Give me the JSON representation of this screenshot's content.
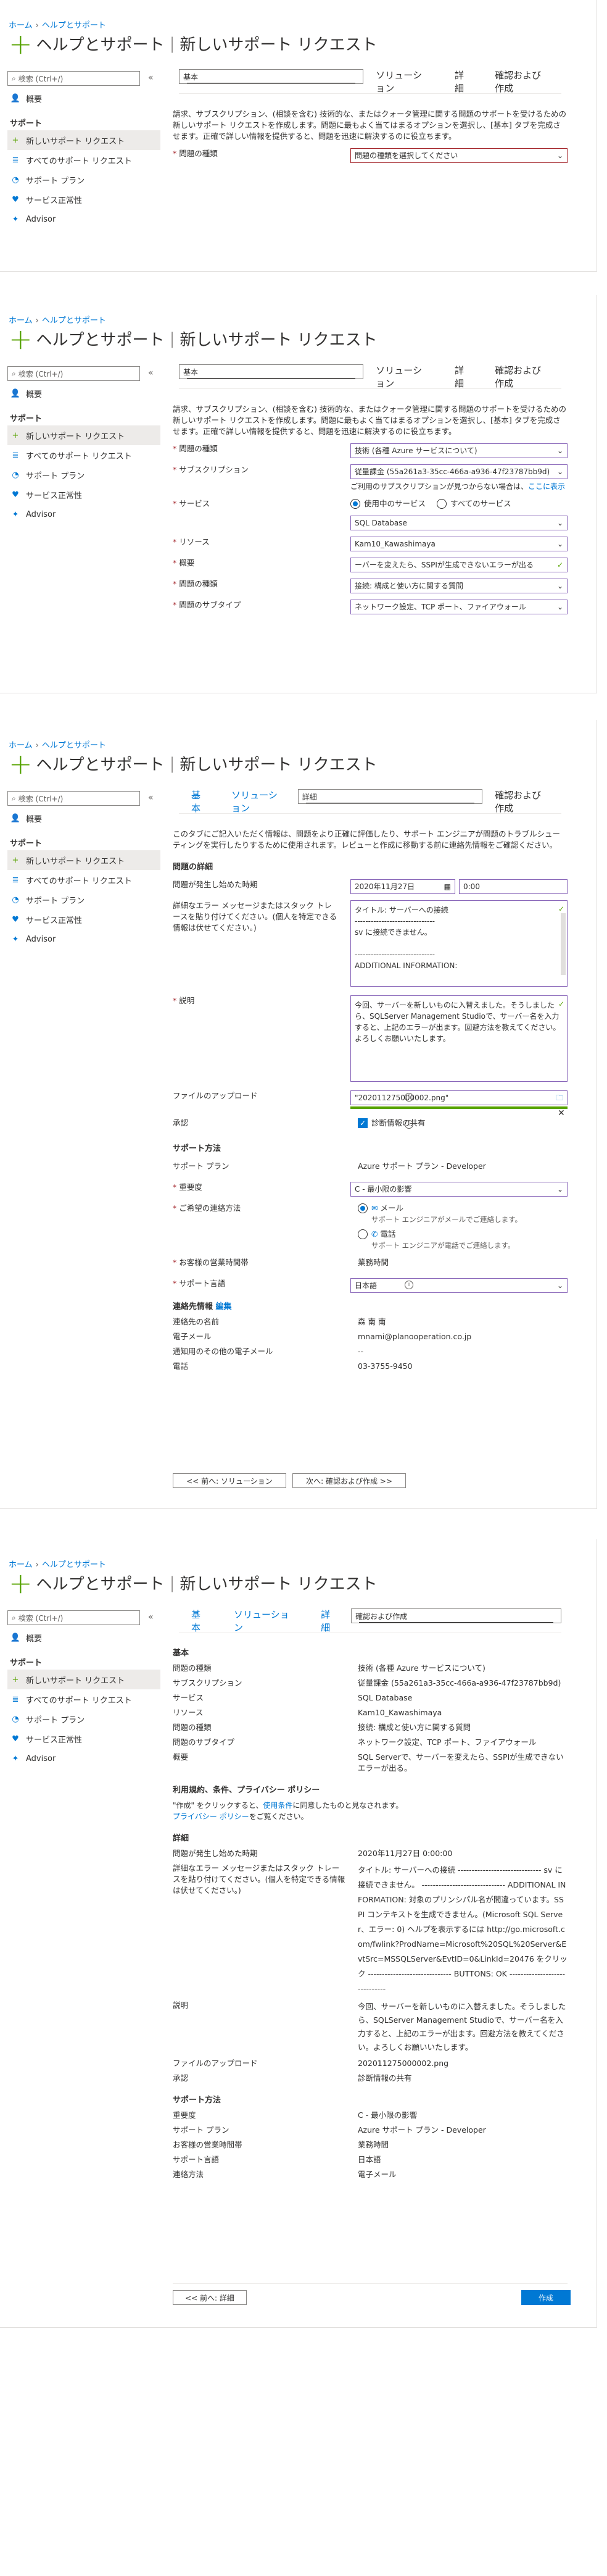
{
  "common": {
    "breadcrumb_home": "ホーム",
    "breadcrumb_help": "ヘルプとサポート",
    "title_main": "ヘルプとサポート",
    "title_sub": "新しいサポート リクエスト",
    "search_placeholder": "検索 (Ctrl+/)",
    "collapse": "«",
    "sidebar": {
      "overview": "概要",
      "support_section": "サポート",
      "new_request": "新しいサポート リクエスト",
      "all_requests": "すべてのサポート リクエスト",
      "support_plan": "サポート プラン",
      "service_health": "サービス正常性",
      "advisor": "Advisor"
    },
    "tabs": {
      "basic": "基本",
      "solution": "ソリューション",
      "details": "詳細",
      "review": "確認および作成"
    },
    "intro": "請求、サブスクリプション、(相談を含む) 技術的な、またはクォータ管理に関する問題のサポートを受けるための新しいサポート リクエストを作成します。問題に最もよく当てはまるオプションを選択し、[基本] タブを完成させます。正確で詳しい情報を提供すると、問題を迅速に解決するのに役立ちます。"
  },
  "panel1": {
    "issue_type_label": "問題の種類",
    "issue_type_value": "問題の種類を選択してください"
  },
  "panel2": {
    "issue_type_label": "問題の種類",
    "issue_type_value": "技術 (各種 Azure サービスについて)",
    "subscription_label": "サブスクリプション",
    "subscription_value": "従量課金 (55a261a3-35cc-466a-a936-47f23787bb9d)",
    "subscription_help": "ご利用のサブスクリプションが見つからない場合は、",
    "subscription_help_link": "ここに表示",
    "service_label": "サービス",
    "service_radio1": "使用中のサービス",
    "service_radio2": "すべてのサービス",
    "service_value": "SQL Database",
    "resource_label": "リソース",
    "resource_value": "Kam10_Kawashimaya",
    "summary_label": "概要",
    "summary_value": "ーバーを変えたら、SSPIが生成できないエラーが出る",
    "problem_type_label": "問題の種類",
    "problem_type_value": "接続: 構成と使い方に関する質問",
    "subtype_label": "問題のサブタイプ",
    "subtype_value": "ネットワーク設定、TCP ポート、ファイアウォール"
  },
  "panel3": {
    "intro": "このタブにご記入いただく情報は、問題をより正確に評価したり、サポート エンジニアが問題のトラブルシューティングを実行したりするために使用されます。レビューと作成に移動する前に連絡先情報をご確認ください。",
    "issue_details_hdr": "問題の詳細",
    "start_time_label": "問題が発生し始めた時期",
    "start_date": "2020年11月27日",
    "start_time": "0:00",
    "error_label": "詳細なエラー メッセージまたはスタック トレースを貼り付けてください。(個人を特定できる情報は伏せてください。)",
    "error_lines": [
      "タイトル: サーバーへの接続",
      "------------------------------",
      "sv に接続できません。",
      "",
      "------------------------------",
      "ADDITIONAL INFORMATION:"
    ],
    "desc_label": "説明",
    "desc_text": "今回、サーバーを新しいものに入替えました。そうしましたら、SQLServer Management Studioで、サーバー名を入力すると、上記のエラーが出ます。回避方法を教えてください。よろしくお願いいたします。",
    "upload_label": "ファイルのアップロード",
    "upload_value": "\"202011275000002.png\"",
    "consent_label": "承認",
    "consent_value": "診断情報の共有",
    "support_method_hdr": "サポート方法",
    "plan_label": "サポート プラン",
    "plan_value": "Azure サポート プラン - Developer",
    "severity_label": "重要度",
    "severity_value": "C - 最小限の影響",
    "contact_label": "ご希望の連絡方法",
    "contact_email": "メール",
    "contact_email_sub": "サポート エンジニアがメールでご連絡します。",
    "contact_phone": "電話",
    "contact_phone_sub": "サポート エンジニアが電話でご連絡します。",
    "hours_label": "お客様の営業時間帯",
    "hours_value": "業務時間",
    "lang_label": "サポート言語",
    "lang_value": "日本語",
    "contact_info_hdr": "連絡先情報",
    "edit_link": "編集",
    "name_label": "連絡先の名前",
    "name_value": "森 南 南",
    "email_label": "電子メール",
    "email_value": "mnami@planooperation.co.jp",
    "other_email_label": "通知用のその他の電子メール",
    "other_email_value": "--",
    "phone_label": "電話",
    "phone_value": "03-3755-9450",
    "prev_btn": "<< 前へ: ソリューション",
    "next_btn": "次へ: 確認および作成 >>"
  },
  "panel4": {
    "basic_hdr": "基本",
    "rows_basic": [
      {
        "k": "問題の種類",
        "v": "技術 (各種 Azure サービスについて)"
      },
      {
        "k": "サブスクリプション",
        "v": "従量課金 (55a261a3-35cc-466a-a936-47f23787bb9d)"
      },
      {
        "k": "サービス",
        "v": "SQL Database"
      },
      {
        "k": "リソース",
        "v": "Kam10_Kawashimaya"
      },
      {
        "k": "問題の種類",
        "v": "接続: 構成と使い方に関する質問"
      },
      {
        "k": "問題のサブタイプ",
        "v": "ネットワーク設定、TCP ポート、ファイアウォール"
      },
      {
        "k": "概要",
        "v": "SQL Serverで、サーバーを変えたら、SSPIが生成できないエラーが出る。"
      }
    ],
    "terms_hdr": "利用規約、条件、プライバシー ポリシー",
    "terms_text1": "\"作成\" をクリックすると、",
    "terms_link1": "使用条件",
    "terms_text2": "に同意したものと見なされます。",
    "terms_link2": "プライバシー ポリシー",
    "terms_text3": "をご覧ください。",
    "details_hdr": "詳細",
    "start_label": "問題が発生し始めた時期",
    "start_value": "2020年11月27日 0:00:00",
    "error_label": "詳細なエラー メッセージまたはスタック トレースを貼り付けてください。(個人を特定できる情報は伏せてください。)",
    "error_value": "タイトル: サーバーへの接続 ------------------------------ sv に接続できません。 ------------------------------ ADDITIONAL INFORMATION: 対象のプリンシパル名が間違っています。SSPI コンテキストを生成できません。(Microsoft SQL Server、エラー: 0) ヘルプを表示するには http://go.microsoft.com/fwlink?ProdName=Microsoft%20SQL%20Server&EvtSrc=MSSQLServer&EvtID=0&LinkId=20476 をクリック ------------------------------ BUTTONS: OK ------------------------------",
    "desc_label": "説明",
    "desc_value": "今回、サーバーを新しいものに入替えました。そうしましたら、SQLServer Management Studioで、サーバー名を入力すると、上記のエラーが出ます。回避方法を教えてください。よろしくお願いいたします。",
    "upload_label": "ファイルのアップロード",
    "upload_value": "202011275000002.png",
    "consent_label": "承認",
    "consent_value": "診断情報の共有",
    "method_hdr": "サポート方法",
    "rows_method": [
      {
        "k": "重要度",
        "v": "C - 最小限の影響"
      },
      {
        "k": "サポート プラン",
        "v": "Azure サポート プラン - Developer"
      },
      {
        "k": "お客様の営業時間帯",
        "v": "業務時間"
      },
      {
        "k": "サポート言語",
        "v": "日本語"
      },
      {
        "k": "連絡方法",
        "v": "電子メール"
      }
    ],
    "prev_btn": "<< 前へ: 詳細",
    "create_btn": "作成"
  }
}
